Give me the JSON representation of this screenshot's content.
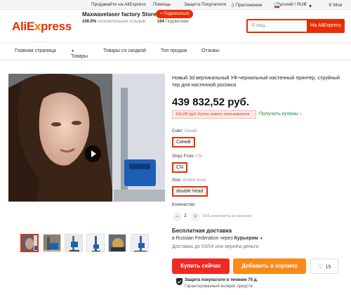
{
  "topbar": {
    "sell": "Продавайте на AliExpress",
    "help": "Помощь",
    "protection": "Защита Покупателя",
    "app": "Приложение",
    "locale": "/ Русский / RUB",
    "account": "Мои"
  },
  "header": {
    "logo_main": "AliE",
    "logo_x": "x",
    "logo_rest": "press",
    "store_name": "Maxwavelaser factory Store",
    "store_rating_value": "100.0%",
    "store_rating_label": "положительных отзывов",
    "subscribe": "+ Подписаться",
    "subscribers_count": "104",
    "subscribers_label": "Подписчики",
    "search_placeholder": "Я ищу...",
    "search_button": "На AliExpress"
  },
  "nav": {
    "items": [
      "Главная страница",
      "Товары",
      "Товары со скидкой",
      "Топ продаж",
      "Отзывы"
    ]
  },
  "product": {
    "title": "Новый 3d вертикальный УФ-чернильный настенный принтер, струйный тер для настенной росписи",
    "price": "439 832,52 руб.",
    "coupon": "150,00 руб. Купон нового пользователя",
    "get_coupons": "Получить купоны",
    "options": [
      {
        "label": "Color:",
        "value": "Синий",
        "selected": "Синий"
      },
      {
        "label": "Ships From:",
        "value": "CN",
        "selected": "CN"
      },
      {
        "label": "Size:",
        "value": "double head",
        "selected": "double head"
      }
    ],
    "quantity_label": "Количество:",
    "quantity": "1",
    "available": "666 комплекты в наличии",
    "shipping_title": "Бесплатная доставка",
    "shipping_dest_prefix": "в Russian Federation через",
    "shipping_carrier": "Курьером",
    "shipping_eta": "Доставка до 03/04 или вернём деньги",
    "buy_now": "Купить сейчас",
    "add_to_cart": "Добавить в корзину",
    "wishlist_count": "15",
    "protection_title": "Защита покупателя в течение 75 д.",
    "protection_sub": "Гарантированный возврат средств"
  },
  "colors": {
    "brand_red": "#e62e04",
    "buy_red": "#ee2a24",
    "cart_orange": "#f98a1a",
    "coupon_green": "#1a8a3a"
  }
}
